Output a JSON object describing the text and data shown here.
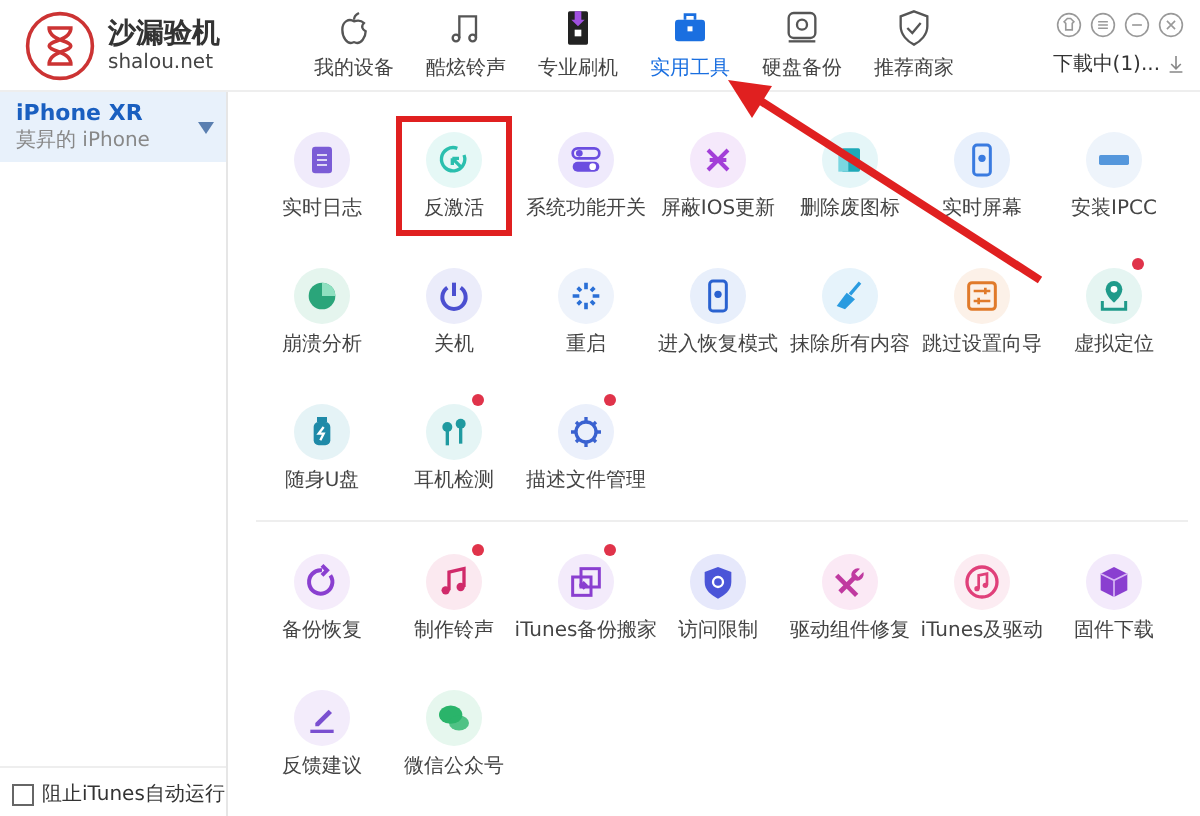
{
  "app": {
    "name": "沙漏验机",
    "site": "shalou.net"
  },
  "nav": [
    {
      "label": "我的设备",
      "selected": false
    },
    {
      "label": "酷炫铃声",
      "selected": false
    },
    {
      "label": "专业刷机",
      "selected": false
    },
    {
      "label": "实用工具",
      "selected": true
    },
    {
      "label": "硬盘备份",
      "selected": false
    },
    {
      "label": "推荐商家",
      "selected": false
    }
  ],
  "download": "下載中(1)...",
  "sidebar": {
    "device": {
      "name": "iPhone XR",
      "subtitle": "莫昇的 iPhone",
      "selected": true
    },
    "option": {
      "label": "阻止iTunes自动运行",
      "checked": false
    }
  },
  "tools": [
    {
      "label": "实时日志",
      "badge": false,
      "highlighted": false
    },
    {
      "label": "反激活",
      "badge": false,
      "highlighted": true
    },
    {
      "label": "系统功能开关",
      "badge": false,
      "highlighted": false
    },
    {
      "label": "屏蔽IOS更新",
      "badge": false,
      "highlighted": false
    },
    {
      "label": "删除废图标",
      "badge": false,
      "highlighted": false
    },
    {
      "label": "实时屏幕",
      "badge": false,
      "highlighted": false
    },
    {
      "label": "安装IPCC",
      "badge": false,
      "highlighted": false
    },
    {
      "label": "崩溃分析",
      "badge": false,
      "highlighted": false
    },
    {
      "label": "关机",
      "badge": false,
      "highlighted": false
    },
    {
      "label": "重启",
      "badge": false,
      "highlighted": false
    },
    {
      "label": "进入恢复模式",
      "badge": false,
      "highlighted": false
    },
    {
      "label": "抹除所有内容",
      "badge": false,
      "highlighted": false
    },
    {
      "label": "跳过设置向导",
      "badge": false,
      "highlighted": false
    },
    {
      "label": "虚拟定位",
      "badge": true,
      "highlighted": false
    },
    {
      "label": "随身U盘",
      "badge": false,
      "highlighted": false
    },
    {
      "label": "耳机检测",
      "badge": true,
      "highlighted": false
    },
    {
      "label": "描述文件管理",
      "badge": true,
      "highlighted": false
    }
  ],
  "extras": [
    {
      "label": "备份恢复",
      "badge": false
    },
    {
      "label": "制作铃声",
      "badge": true
    },
    {
      "label": "iTunes备份搬家",
      "badge": true
    },
    {
      "label": "访问限制",
      "badge": false
    },
    {
      "label": "驱动组件修复",
      "badge": false
    },
    {
      "label": "iTunes及驱动",
      "badge": false
    },
    {
      "label": "固件下载",
      "badge": false
    },
    {
      "label": "反馈建议",
      "badge": false
    },
    {
      "label": "微信公众号",
      "badge": false
    }
  ]
}
